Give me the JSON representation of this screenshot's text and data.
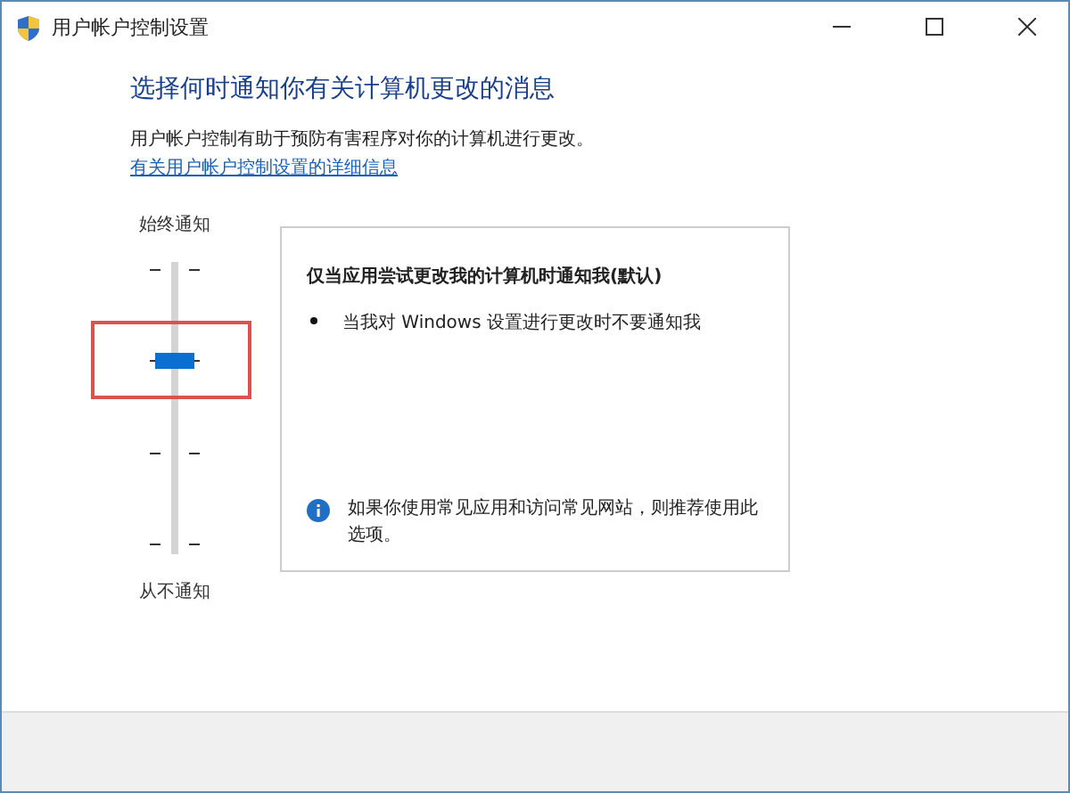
{
  "window": {
    "title": "用户帐户控制设置"
  },
  "heading": "选择何时通知你有关计算机更改的消息",
  "description": "用户帐户控制有助于预防有害程序对你的计算机进行更改。",
  "link": "有关用户帐户控制设置的详细信息",
  "slider": {
    "top_label": "始终通知",
    "bottom_label": "从不通知",
    "level": 0.67,
    "highlighted": true
  },
  "panel": {
    "title": "仅当应用尝试更改我的计算机时通知我(默认)",
    "bullets": [
      "当我对 Windows 设置进行更改时不要通知我"
    ],
    "note": "如果你使用常见应用和访问常见网站，则推荐使用此选项。"
  }
}
